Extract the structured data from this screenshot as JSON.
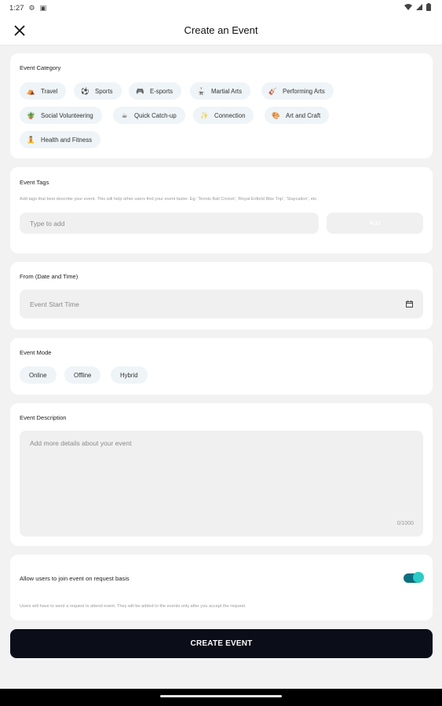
{
  "status_bar": {
    "time": "1:27"
  },
  "header": {
    "title": "Create an Event"
  },
  "category": {
    "label": "Event Category",
    "chips": [
      {
        "label": "Travel",
        "icon": "⛺"
      },
      {
        "label": "Sports",
        "icon": "⚽"
      },
      {
        "label": "E-sports",
        "icon": "🎮"
      },
      {
        "label": "Martial Arts",
        "icon": "🥋"
      },
      {
        "label": "Performing Arts",
        "icon": "🎸"
      },
      {
        "label": "Social Volunteering",
        "icon": "🪴"
      },
      {
        "label": "Quick Catch-up",
        "icon": "☕"
      },
      {
        "label": "Connection",
        "icon": "✨"
      },
      {
        "label": "Art and Craft",
        "icon": "🎨"
      },
      {
        "label": "Health and Fitness",
        "icon": "🧘"
      }
    ]
  },
  "tags": {
    "label": "Event Tags",
    "help": "Add tags that best describe your event. This will help other users find your event faster. Eg: 'Tennis Ball Cricket', 'Royal Enfield Bike Trip', 'Staycation', etc.",
    "input_placeholder": "Type to add",
    "add_label": "Add"
  },
  "from": {
    "label": "From (Date and Time)",
    "placeholder": "Event Start Time"
  },
  "mode": {
    "label": "Event Mode",
    "options": [
      "Online",
      "Offline",
      "Hybrid"
    ]
  },
  "description": {
    "label": "Event Description",
    "placeholder": "Add more details about your event",
    "counter": "0/1000"
  },
  "request": {
    "label": "Allow users to join event on request basis",
    "enabled": true,
    "help": "Users will have to send a request to attend event. They will be added to the events only after you accept the request."
  },
  "create_button": "CREATE EVENT",
  "colors": {
    "primary_button": "#0b0d18",
    "toggle_track": "#0c6f80",
    "toggle_knob": "#2ccbc6",
    "chip_bg": "#eef4f7"
  }
}
